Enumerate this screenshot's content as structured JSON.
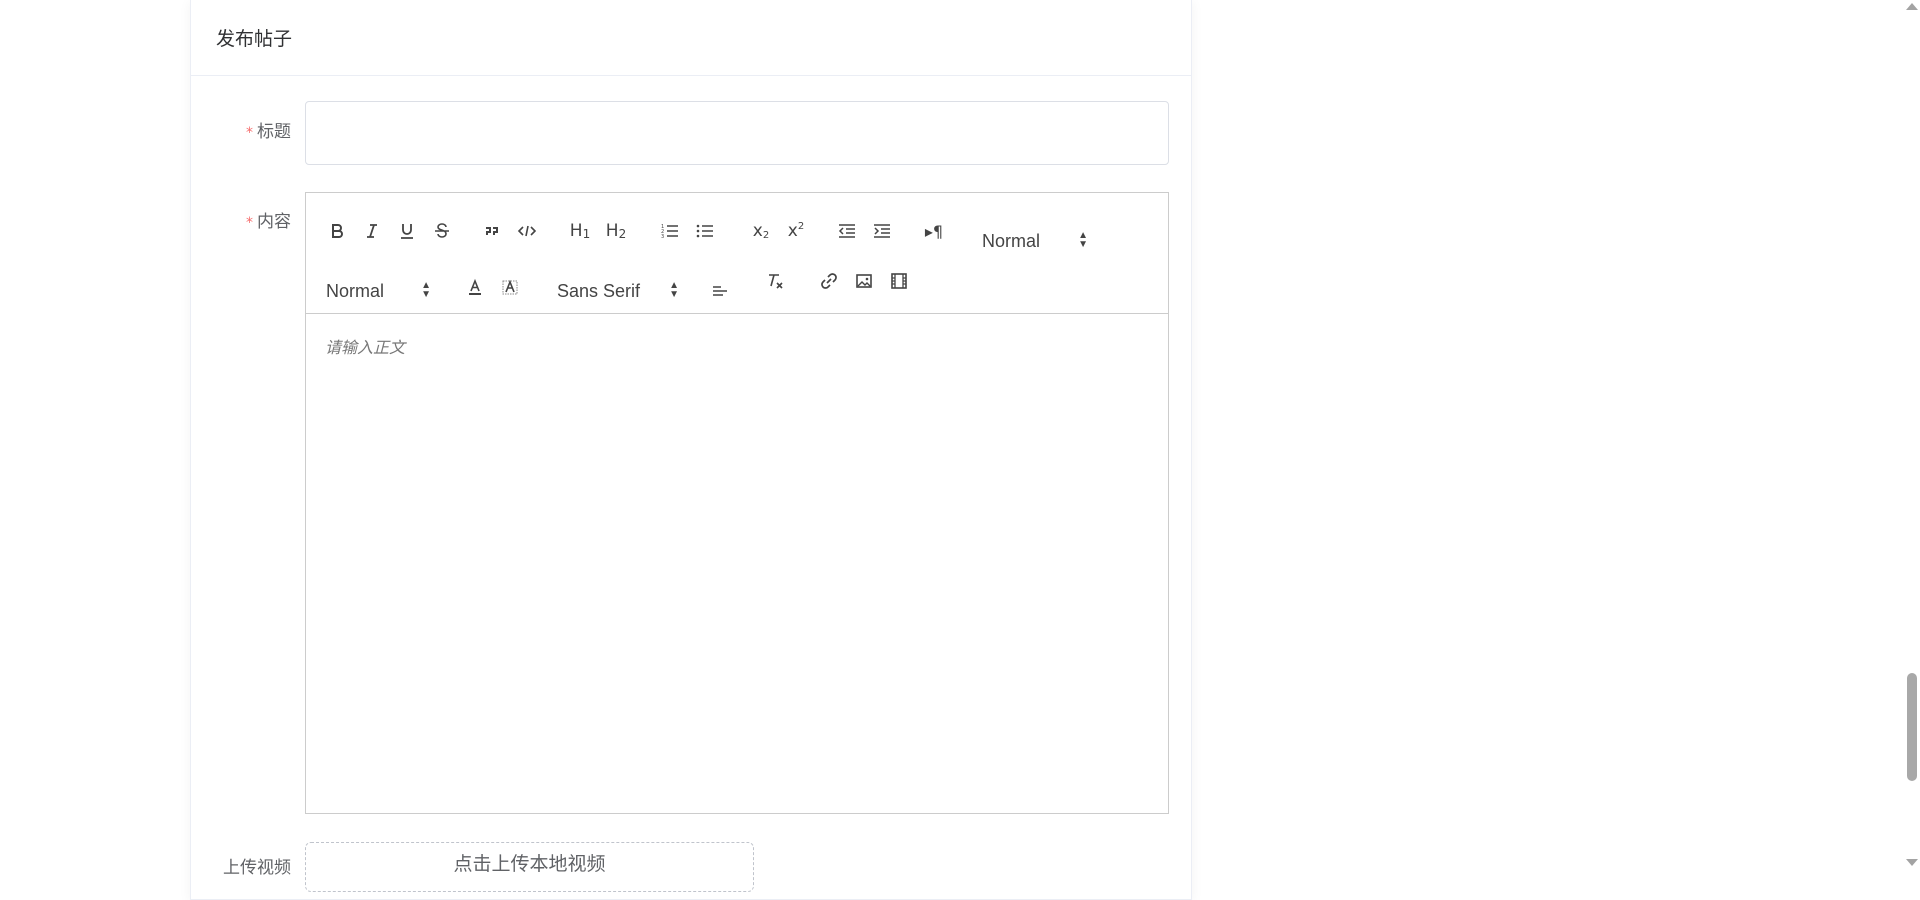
{
  "card": {
    "header_title": "发布帖子"
  },
  "form": {
    "title_label": "标题",
    "content_label": "内容",
    "required_mark": "*",
    "title_value": "",
    "editor_placeholder": "请输入正文",
    "upload_label": "上传视频",
    "upload_button": "点击上传本地视频"
  },
  "toolbar": {
    "header_picker": "Normal",
    "size_picker": "Normal",
    "font_picker": "Sans Serif",
    "icons": [
      "bold-icon",
      "italic-icon",
      "underline-icon",
      "strike-icon",
      "blockquote-icon",
      "code-block-icon",
      "h1-icon",
      "h2-icon",
      "ordered-list-icon",
      "bullet-list-icon",
      "subscript-icon",
      "superscript-icon",
      "outdent-icon",
      "indent-icon",
      "direction-rtl-icon",
      "text-color-icon",
      "background-color-icon",
      "align-icon",
      "clean-format-icon",
      "link-icon",
      "image-icon",
      "video-icon"
    ]
  },
  "colors": {
    "required": "#f56c6c",
    "border": "#dcdfe6",
    "text": "#303133"
  }
}
